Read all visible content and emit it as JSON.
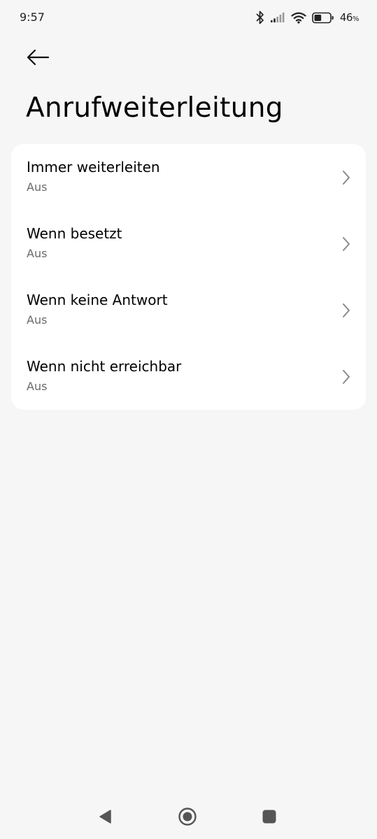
{
  "status_bar": {
    "time": "9:57",
    "battery_percent": "46",
    "battery_unit": "%",
    "battery_level": 0.46,
    "icons": [
      "bluetooth-icon",
      "signal-icon",
      "wifi-icon",
      "battery-icon"
    ]
  },
  "header": {
    "back_icon": "arrow-left-icon",
    "title": "Anrufweiterleitung"
  },
  "forwarding_options": [
    {
      "title": "Immer weiterleiten",
      "status": "Aus"
    },
    {
      "title": "Wenn besetzt",
      "status": "Aus"
    },
    {
      "title": "Wenn keine Antwort",
      "status": "Aus"
    },
    {
      "title": "Wenn nicht erreichbar",
      "status": "Aus"
    }
  ],
  "nav_bar": {
    "icons": [
      "back-triangle-icon",
      "home-circle-icon",
      "recents-square-icon"
    ]
  },
  "colors": {
    "background": "#f6f6f6",
    "card": "#ffffff",
    "secondary_text": "#6b6b6b",
    "chevron": "#8a8a8a"
  }
}
